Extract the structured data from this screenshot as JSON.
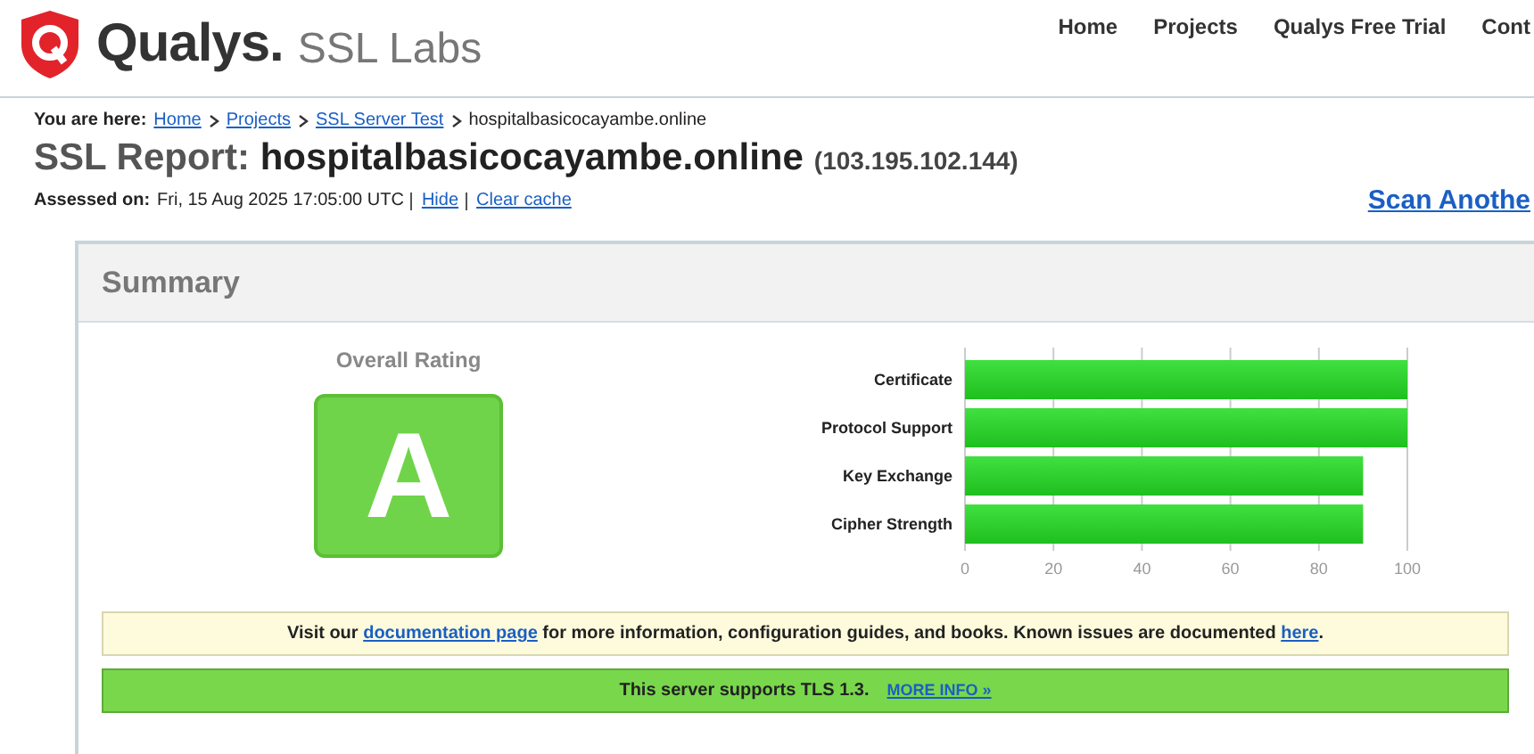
{
  "header": {
    "brand": "Qualys.",
    "product": "SSL Labs",
    "nav": [
      {
        "label": "Home"
      },
      {
        "label": "Projects"
      },
      {
        "label": "Qualys Free Trial"
      },
      {
        "label": "Cont"
      }
    ]
  },
  "breadcrumb": {
    "label": "You are here:",
    "items": [
      {
        "text": "Home",
        "kind": "link"
      },
      {
        "text": "Projects",
        "kind": "link"
      },
      {
        "text": "SSL Server Test",
        "kind": "link"
      },
      {
        "text": "hospitalbasicocayambe.online",
        "kind": "text"
      }
    ]
  },
  "report": {
    "title_prefix": "SSL Report:",
    "host": "hospitalbasicocayambe.online",
    "ip": "(103.195.102.144)",
    "assessed_label": "Assessed on:",
    "assessed_date": "Fri, 15 Aug 2025 17:05:00 UTC",
    "actions": [
      {
        "text": "Hide"
      },
      {
        "text": "Clear cache"
      }
    ],
    "scan_another": "Scan Anothe"
  },
  "summary": {
    "title": "Summary",
    "rating_label": "Overall Rating",
    "grade": "A",
    "chart_data": {
      "type": "bar",
      "orientation": "horizontal",
      "categories": [
        "Certificate",
        "Protocol Support",
        "Key Exchange",
        "Cipher Strength"
      ],
      "series": [
        {
          "color": "#1fbf1f",
          "values": [
            100,
            100,
            90,
            90
          ]
        }
      ],
      "grid": true,
      "xlim": [
        0,
        100
      ],
      "xticks": [
        0,
        20,
        40,
        60,
        80,
        100
      ]
    },
    "notice": [
      {
        "kind": "text",
        "text": "Visit our "
      },
      {
        "kind": "link",
        "text": "documentation page"
      },
      {
        "kind": "text",
        "text": " for more information, configuration guides, and books. Known issues are documented "
      },
      {
        "kind": "link",
        "text": "here"
      },
      {
        "kind": "text",
        "text": "."
      }
    ],
    "tls": {
      "text": "This server supports TLS 1.3.",
      "link": "MORE INFO »"
    }
  }
}
